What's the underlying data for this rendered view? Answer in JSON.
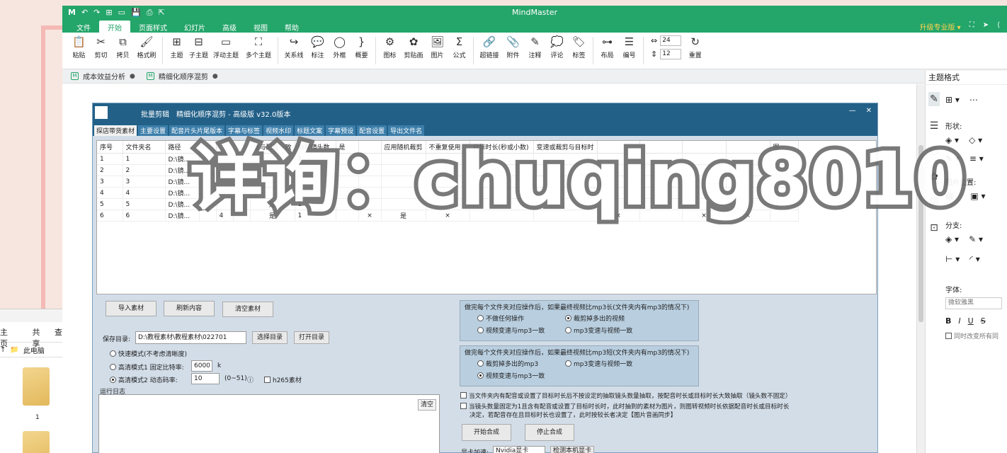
{
  "app": {
    "title": "MindMaster",
    "menu": [
      "文件",
      "开始",
      "页面样式",
      "幻灯片",
      "高级",
      "视图",
      "帮助"
    ],
    "active_menu": "开始",
    "upgrade": "升级专业版 ▾"
  },
  "toolbar": {
    "buttons": [
      {
        "icon": "📋",
        "label": "粘贴"
      },
      {
        "icon": "✂",
        "label": "剪切"
      },
      {
        "icon": "⧉",
        "label": "拷贝"
      },
      {
        "icon": "🖌",
        "label": "格式刷"
      },
      {
        "icon": "⊞",
        "label": "主题"
      },
      {
        "icon": "⊟",
        "label": "子主题"
      },
      {
        "icon": "▭",
        "label": "浮动主题"
      },
      {
        "icon": "⛶",
        "label": "多个主题"
      },
      {
        "icon": "↪",
        "label": "关系线"
      },
      {
        "icon": "💬",
        "label": "标注"
      },
      {
        "icon": "◯",
        "label": "外框"
      },
      {
        "icon": "}",
        "label": "概要"
      },
      {
        "icon": "⚙",
        "label": "图标"
      },
      {
        "icon": "✿",
        "label": "剪贴画"
      },
      {
        "icon": "🖼",
        "label": "图片"
      },
      {
        "icon": "Σ",
        "label": "公式"
      },
      {
        "icon": "🔗",
        "label": "超链接"
      },
      {
        "icon": "📎",
        "label": "附件"
      },
      {
        "icon": "✎",
        "label": "注释"
      },
      {
        "icon": "💭",
        "label": "评论"
      },
      {
        "icon": "🏷",
        "label": "标签"
      },
      {
        "icon": "⊶",
        "label": "布局"
      },
      {
        "icon": "☰",
        "label": "编号"
      }
    ],
    "spin1": "24",
    "spin2": "12",
    "reset_label": "重置"
  },
  "doctabs": [
    {
      "label": "成本效益分析",
      "dot": "●"
    },
    {
      "label": "精细化顺序混剪",
      "dot": "●"
    }
  ],
  "right_panel": {
    "header": "主题格式",
    "shape_label": "形状:",
    "image_pos_label": "图片位置:",
    "branch_label": "分支:",
    "font_label": "字体:",
    "font_value": "微软雅黑",
    "format_buttons": [
      "B",
      "I",
      "U",
      "S"
    ],
    "sync_label": "同时改变所有同"
  },
  "explorer": {
    "tabs": [
      "主页",
      "共享",
      "查"
    ],
    "path": "此电脑",
    "folder_label": "1"
  },
  "software": {
    "name": "批量剪辑",
    "title": "精细化顺序混剪 - 高级版  v32.0版本",
    "tabs": [
      "探店带货素材",
      "主要设置",
      "配音片头片尾版本",
      "字幕与标签",
      "视频水印",
      "标题文案",
      "字幕预设",
      "配音设置",
      "导出文件名"
    ],
    "active_tab": "探店带货素材",
    "columns": [
      "序号",
      "文件夹名",
      "路径",
      "",
      "",
      "",
      "速与配音一致",
      "抽取镜头数",
      "是",
      "",
      "应用随机裁剪",
      "不重复使用",
      "目标时长(秒或小数)",
      "变速或裁剪与目标时",
      "",
      "",
      "",
      "",
      "图"
    ],
    "rows": [
      [
        "1",
        "1",
        "D:\\镜...",
        "",
        "",
        "",
        "",
        "1",
        "",
        "",
        "",
        "",
        "",
        "",
        "",
        "",
        "",
        "",
        ""
      ],
      [
        "2",
        "2",
        "D:\\镜...",
        "",
        "",
        "",
        "",
        "",
        "",
        "",
        "",
        "",
        "",
        "",
        "",
        "",
        "",
        "",
        ""
      ],
      [
        "3",
        "3",
        "D:\\镜...",
        "",
        "",
        "",
        "",
        "",
        "",
        "",
        "",
        "",
        "",
        "",
        "",
        "",
        "",
        "",
        ""
      ],
      [
        "4",
        "4",
        "D:\\镜...",
        "",
        "",
        "",
        "",
        "",
        "",
        "",
        "",
        "",
        "",
        "",
        "",
        "",
        "",
        "",
        ""
      ],
      [
        "5",
        "5",
        "D:\\镜...",
        "",
        "",
        "",
        "是",
        "1",
        "",
        "",
        "",
        "",
        "",
        "",
        "",
        "",
        "",
        "",
        ""
      ],
      [
        "6",
        "6",
        "D:\\镜...",
        "",
        "4",
        "",
        "是",
        "1",
        "",
        "×",
        "是",
        "×",
        "",
        "",
        "×",
        "",
        "×",
        "×",
        ""
      ]
    ],
    "btn_import": "导入素材",
    "btn_refresh": "刷新内容",
    "btn_clear": "清空素材",
    "save_dir_label": "保存目录:",
    "save_dir_value": "D:\\教程素材\\教程素材\\022701",
    "btn_select_dir": "选择目录",
    "btn_open_dir": "打开目录",
    "mode_fast": "快速模式(不考虑清晰度)",
    "mode_hq1": "高清模式1 固定比特率:",
    "bitrate": "6000",
    "bitrate_unit": "k",
    "mode_hq2": "高清模式2 动态码率:",
    "dyn_rate": "10",
    "dyn_range": "(0~51)",
    "h265": "h265素材",
    "log_label": "运行日志",
    "btn_clear_log": "清空",
    "group1_title": "做完每个文件夹对应操作后，如果最终视频比mp3长(文件夹内有mp3的情况下)",
    "g1_opt1": "不做任何操作",
    "g1_opt2": "裁剪掉多出的视频",
    "g1_opt3": "视频变速与mp3一致",
    "g1_opt4": "mp3变速与视频一致",
    "group2_title": "做完每个文件夹对应操作后，如果最终视频比mp3短(文件夹内有mp3的情况下)",
    "g2_opt1": "裁剪掉多出的mp3",
    "g2_opt2": "mp3变速与视频一致",
    "g2_opt3": "视频变速与mp3一致",
    "check1": "当文件夹内有配音或设置了目标时长后不按设定的抽取镜头数量抽取，按配音时长或目标时长大致抽取（镜头数不固定）",
    "check2a": "当镜头数量固定为1且含有配音或设置了目标时长时，此时抽到的素材为图片，则图转视频时长依据配音时长或目标时长",
    "check2b": "决定，若配音存在且目标时长也设置了，此时按较长者决定【图片音画同步】",
    "btn_start": "开始合成",
    "btn_stop": "停止合成",
    "gpu_label": "显卡加速:",
    "gpu_value": "Nvidia显卡",
    "btn_detect": "检测本机显卡"
  },
  "watermark": "详询：chuqing8010"
}
